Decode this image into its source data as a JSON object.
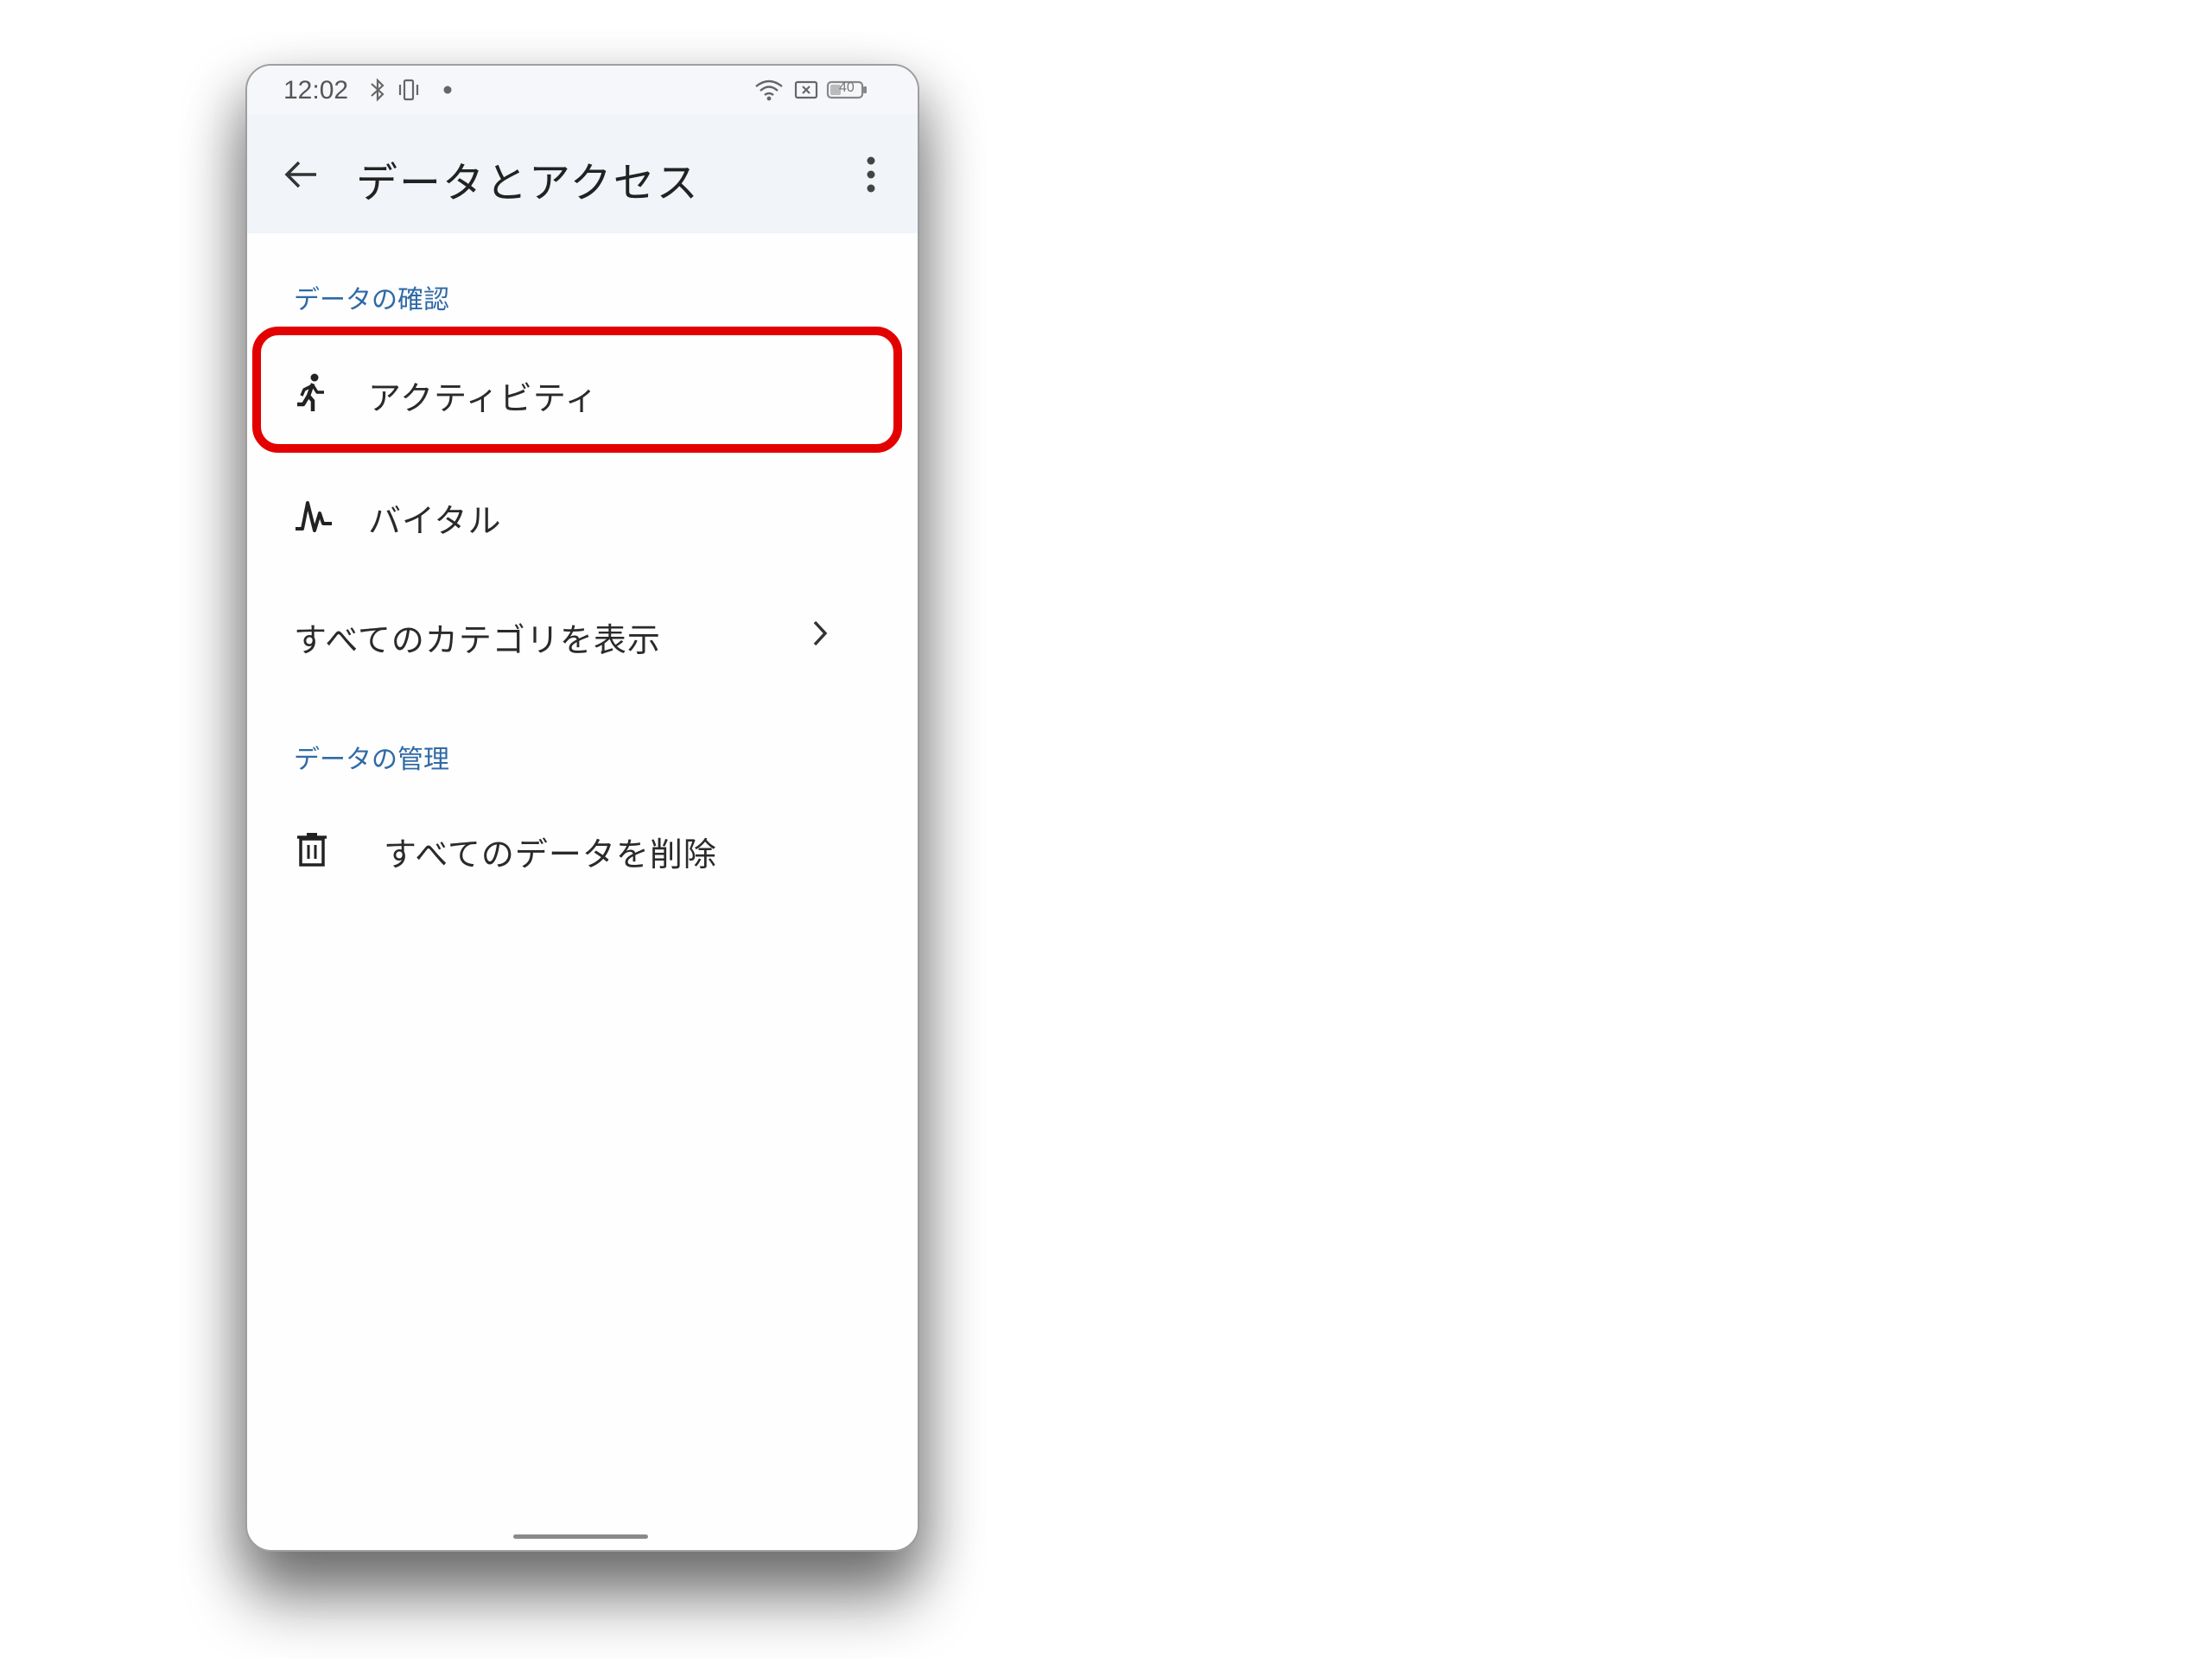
{
  "status_bar": {
    "time": "12:02",
    "icons": [
      "bluetooth-icon",
      "vibrate-icon",
      "notification-dot-icon",
      "wifi-icon",
      "no-sim-icon",
      "battery-icon"
    ],
    "battery_level": "40"
  },
  "app_bar": {
    "title": "データとアクセス",
    "back_icon": "arrow-back-icon",
    "menu_icon": "more-vert-icon"
  },
  "sections": {
    "review": {
      "header": "データの確認",
      "items": [
        {
          "label": "アクティビティ",
          "icon": "run-icon"
        },
        {
          "label": "バイタル",
          "icon": "vitals-icon"
        }
      ],
      "see_all": {
        "label": "すべてのカテゴリを表示",
        "icon": "chevron-right-icon"
      }
    },
    "manage": {
      "header": "データの管理",
      "items": [
        {
          "label": "すべてのデータを削除",
          "icon": "trash-icon"
        }
      ]
    }
  },
  "colors": {
    "section_header": "#2f6aa6",
    "highlight": "#e30000",
    "app_bar_bg": "#f1f4f8"
  }
}
